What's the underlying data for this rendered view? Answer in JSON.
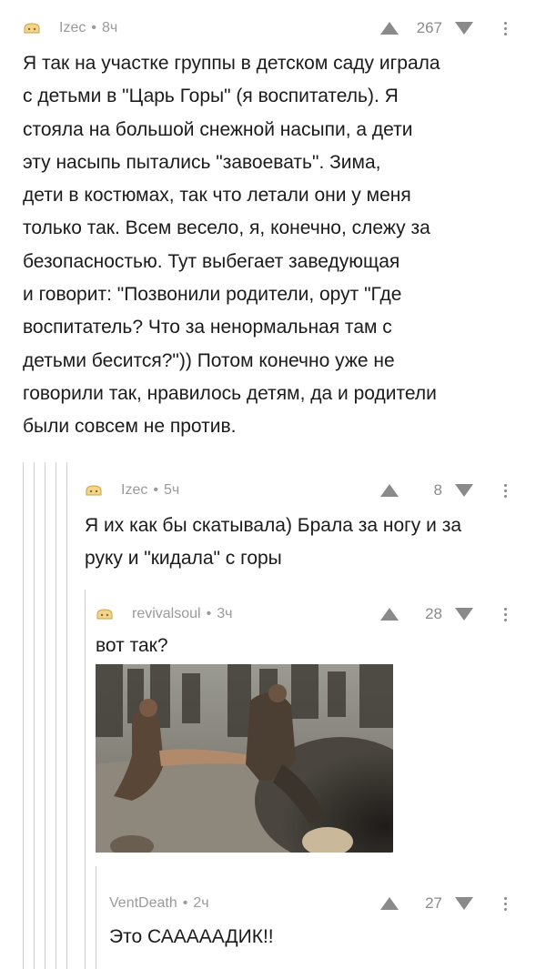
{
  "comments": [
    {
      "author": "Izec",
      "time": "8ч",
      "votes": "267",
      "text": "Я так на участке группы в детском саду играла\nс детьми в \"Царь Горы\" (я воспитатель). Я\nстояла на большой снежной насыпи, а дети\nэту насыпь пытались \"завоевать\". Зима,\nдети в костюмах, так что летали они у меня\nтолько так. Всем весело, я, конечно, слежу за\nбезопасностью. Тут выбегает заведующая\nи говорит: \"Позвонили родители, орут \"Где\nвоспитатель? Что за ненормальная там с\nдетьми бесится?\")) Потом конечно уже не\nговорили так, нравилось детям, да и родители\nбыли совсем не против."
    },
    {
      "author": "Izec",
      "time": "5ч",
      "votes": "8",
      "text": "Я их как бы скатывала) Брала за ногу и за\nруку и \"кидала\" с горы"
    },
    {
      "author": "revivalsoul",
      "time": "3ч",
      "votes": "28",
      "text": "вот так?",
      "image_alt": "кадр из фильма: воин сталкивает человека в яму"
    },
    {
      "author": "VentDeath",
      "time": "2ч",
      "votes": "27",
      "text": "Это САААААДИК!!"
    }
  ],
  "separator": "•",
  "colors": {
    "text": "#1b1b1b",
    "meta": "#9a9a9a",
    "icon": "#8a8a8a",
    "thread_line": "#cfcfcf"
  },
  "icons": {
    "avatar": "avatar-icon",
    "upvote": "upvote-icon",
    "downvote": "downvote-icon",
    "more": "more-icon"
  }
}
